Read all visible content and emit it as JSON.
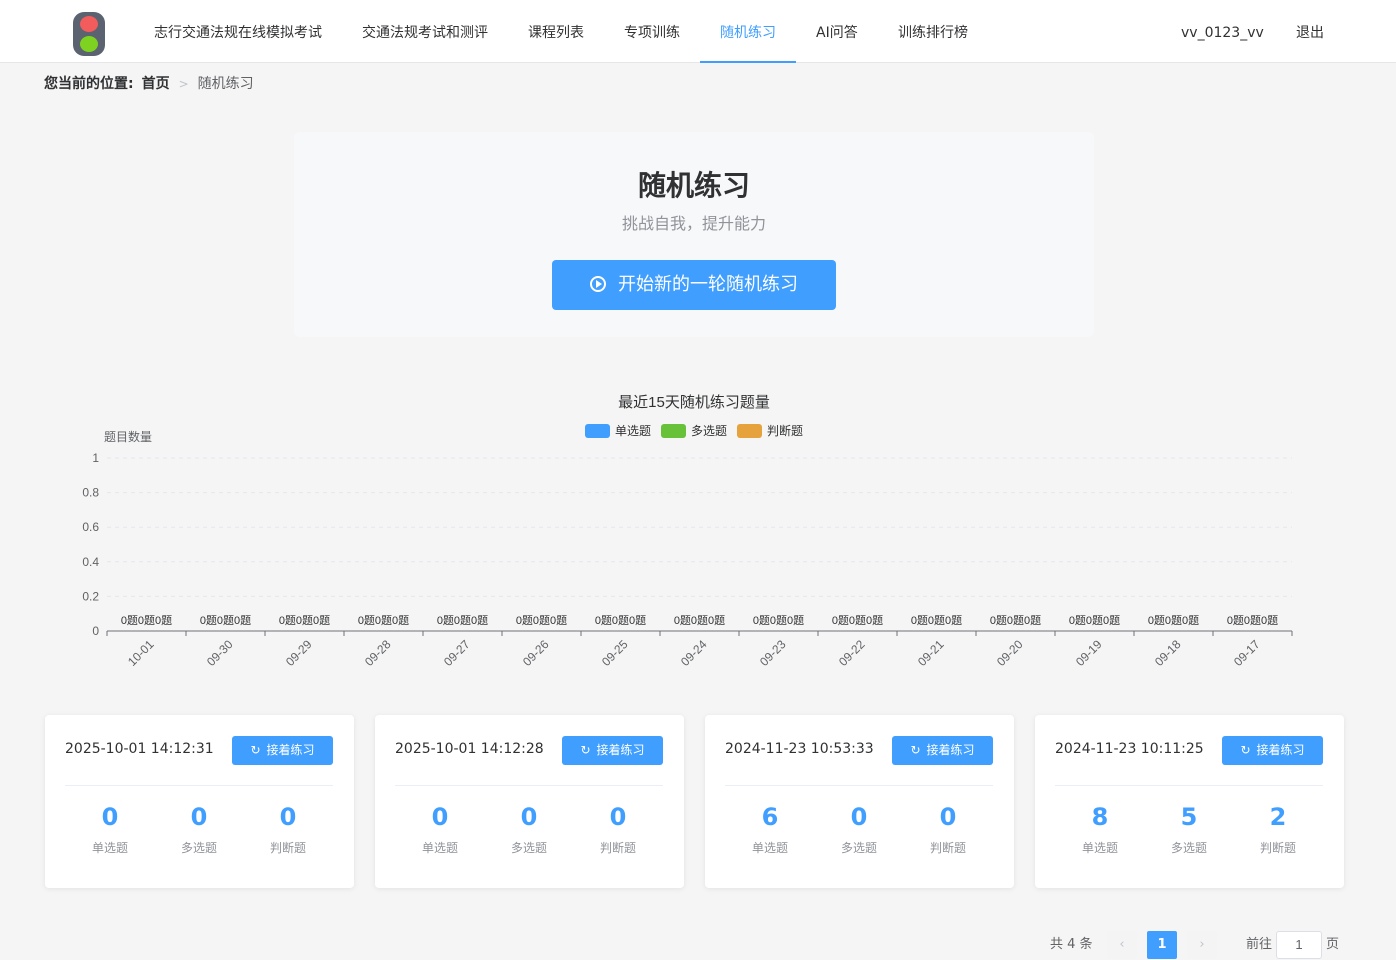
{
  "header": {
    "nav": [
      {
        "label": "志行交通法规在线模拟考试",
        "active": false
      },
      {
        "label": "交通法规考试和测评",
        "active": false
      },
      {
        "label": "课程列表",
        "active": false
      },
      {
        "label": "专项训练",
        "active": false
      },
      {
        "label": "随机练习",
        "active": true
      },
      {
        "label": "AI问答",
        "active": false
      },
      {
        "label": "训练排行榜",
        "active": false
      }
    ],
    "username": "vv_0123_vv",
    "logout": "退出"
  },
  "breadcrumb": {
    "prefix": "您当前的位置:",
    "home": "首页",
    "current": "随机练习"
  },
  "hero": {
    "title": "随机练习",
    "subtitle": "挑战自我，提升能力",
    "start_button": "开始新的一轮随机练习"
  },
  "chart_data": {
    "type": "bar",
    "title": "最近15天随机练习题量",
    "ylabel": "题目数量",
    "xlabel": "",
    "ylim": [
      0,
      1
    ],
    "yticks": [
      "0",
      "0.2",
      "0.4",
      "0.6",
      "0.8",
      "1"
    ],
    "categories": [
      "10-01",
      "09-30",
      "09-29",
      "09-28",
      "09-27",
      "09-26",
      "09-25",
      "09-24",
      "09-23",
      "09-22",
      "09-21",
      "09-20",
      "09-19",
      "09-18",
      "09-17"
    ],
    "series": [
      {
        "name": "单选题",
        "color": "#409eff",
        "values": [
          0,
          0,
          0,
          0,
          0,
          0,
          0,
          0,
          0,
          0,
          0,
          0,
          0,
          0,
          0
        ]
      },
      {
        "name": "多选题",
        "color": "#67c23a",
        "values": [
          0,
          0,
          0,
          0,
          0,
          0,
          0,
          0,
          0,
          0,
          0,
          0,
          0,
          0,
          0
        ]
      },
      {
        "name": "判断题",
        "color": "#e6a23c",
        "values": [
          0,
          0,
          0,
          0,
          0,
          0,
          0,
          0,
          0,
          0,
          0,
          0,
          0,
          0,
          0
        ]
      }
    ],
    "data_label_unit": "题",
    "legend_position": "top-center",
    "grid": true
  },
  "records": {
    "continue_label": "接着练习",
    "stat_labels": [
      "单选题",
      "多选题",
      "判断题"
    ],
    "items": [
      {
        "time": "2025-10-01 14:12:31",
        "single": "0",
        "multi": "0",
        "judge": "0"
      },
      {
        "time": "2025-10-01 14:12:28",
        "single": "0",
        "multi": "0",
        "judge": "0"
      },
      {
        "time": "2024-11-23 10:53:33",
        "single": "6",
        "multi": "0",
        "judge": "0"
      },
      {
        "time": "2024-11-23 10:11:25",
        "single": "8",
        "multi": "5",
        "judge": "2"
      }
    ]
  },
  "pagination": {
    "total": "共 4 条",
    "current_page": "1",
    "goto_label": "前往",
    "goto_value": "1",
    "page_suffix": "页"
  }
}
